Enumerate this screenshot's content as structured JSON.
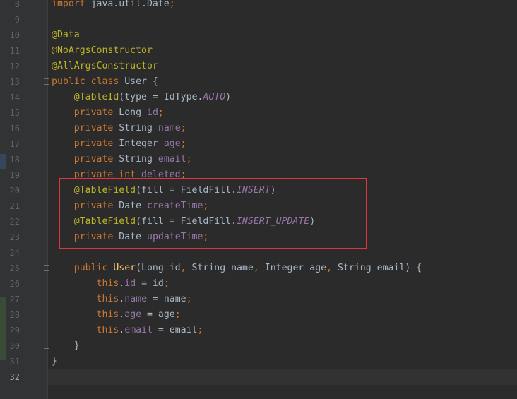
{
  "editor": {
    "colors": {
      "background": "#2b2b2b",
      "gutter": "#313335",
      "keyword": "#cc7832",
      "annotation": "#bbb529",
      "field": "#9876aa",
      "plain": "#a9b7c6",
      "method": "#ffc66d",
      "highlight_box": "#e0353b"
    },
    "current_line": "32",
    "lines": [
      {
        "n": "8",
        "segs": [
          [
            "kw",
            "import"
          ],
          [
            "pl",
            " java.util.Date"
          ],
          [
            "kw",
            ";"
          ]
        ]
      },
      {
        "n": "9",
        "segs": []
      },
      {
        "n": "10",
        "segs": [
          [
            "ann",
            "@Data"
          ]
        ]
      },
      {
        "n": "11",
        "segs": [
          [
            "ann",
            "@NoArgsConstructor"
          ]
        ]
      },
      {
        "n": "12",
        "segs": [
          [
            "ann",
            "@AllArgsConstructor"
          ]
        ]
      },
      {
        "n": "13",
        "fold": true,
        "segs": [
          [
            "kw",
            "public class "
          ],
          [
            "pl",
            "User {"
          ]
        ]
      },
      {
        "n": "14",
        "segs": [
          [
            "pl",
            "    "
          ],
          [
            "ann",
            "@TableId"
          ],
          [
            "pl",
            "(type = IdType."
          ],
          [
            "cst",
            "AUTO"
          ],
          [
            "pl",
            ")"
          ]
        ]
      },
      {
        "n": "15",
        "segs": [
          [
            "pl",
            "    "
          ],
          [
            "kw",
            "private "
          ],
          [
            "pl",
            "Long "
          ],
          [
            "fld",
            "id"
          ],
          [
            "kw",
            ";"
          ]
        ]
      },
      {
        "n": "16",
        "segs": [
          [
            "pl",
            "    "
          ],
          [
            "kw",
            "private "
          ],
          [
            "pl",
            "String "
          ],
          [
            "fld",
            "name"
          ],
          [
            "kw",
            ";"
          ]
        ]
      },
      {
        "n": "17",
        "segs": [
          [
            "pl",
            "    "
          ],
          [
            "kw",
            "private "
          ],
          [
            "pl",
            "Integer "
          ],
          [
            "fld",
            "age"
          ],
          [
            "kw",
            ";"
          ]
        ]
      },
      {
        "n": "18",
        "segs": [
          [
            "pl",
            "    "
          ],
          [
            "kw",
            "private "
          ],
          [
            "pl",
            "String "
          ],
          [
            "fld",
            "email"
          ],
          [
            "kw",
            ";"
          ]
        ]
      },
      {
        "n": "19",
        "segs": [
          [
            "pl",
            "    "
          ],
          [
            "kw",
            "private int "
          ],
          [
            "fld",
            "deleted"
          ],
          [
            "kw",
            ";"
          ]
        ]
      },
      {
        "n": "20",
        "segs": [
          [
            "pl",
            "    "
          ],
          [
            "ann",
            "@TableField"
          ],
          [
            "pl",
            "(fill = FieldFill."
          ],
          [
            "cst",
            "INSERT"
          ],
          [
            "pl",
            ")"
          ]
        ]
      },
      {
        "n": "21",
        "segs": [
          [
            "pl",
            "    "
          ],
          [
            "kw",
            "private "
          ],
          [
            "pl",
            "Date "
          ],
          [
            "fld",
            "createTime"
          ],
          [
            "kw",
            ";"
          ]
        ]
      },
      {
        "n": "22",
        "segs": [
          [
            "pl",
            "    "
          ],
          [
            "ann",
            "@TableField"
          ],
          [
            "pl",
            "(fill = FieldFill."
          ],
          [
            "cst",
            "INSERT_UPDATE"
          ],
          [
            "pl",
            ")"
          ]
        ]
      },
      {
        "n": "23",
        "segs": [
          [
            "pl",
            "    "
          ],
          [
            "kw",
            "private "
          ],
          [
            "pl",
            "Date "
          ],
          [
            "fld",
            "updateTime"
          ],
          [
            "kw",
            ";"
          ]
        ]
      },
      {
        "n": "24",
        "segs": []
      },
      {
        "n": "25",
        "fold": true,
        "segs": [
          [
            "pl",
            "    "
          ],
          [
            "kw",
            "public "
          ],
          [
            "mth",
            "User"
          ],
          [
            "pl",
            "(Long id"
          ],
          [
            "kw",
            ", "
          ],
          [
            "pl",
            "String name"
          ],
          [
            "kw",
            ", "
          ],
          [
            "pl",
            "Integer age"
          ],
          [
            "kw",
            ", "
          ],
          [
            "pl",
            "String email) {"
          ]
        ]
      },
      {
        "n": "26",
        "segs": [
          [
            "pl",
            "        "
          ],
          [
            "kw",
            "this"
          ],
          [
            "pl",
            "."
          ],
          [
            "fld",
            "id"
          ],
          [
            "pl",
            " = id"
          ],
          [
            "kw",
            ";"
          ]
        ]
      },
      {
        "n": "27",
        "segs": [
          [
            "pl",
            "        "
          ],
          [
            "kw",
            "this"
          ],
          [
            "pl",
            "."
          ],
          [
            "fld",
            "name"
          ],
          [
            "pl",
            " = name"
          ],
          [
            "kw",
            ";"
          ]
        ]
      },
      {
        "n": "28",
        "segs": [
          [
            "pl",
            "        "
          ],
          [
            "kw",
            "this"
          ],
          [
            "pl",
            "."
          ],
          [
            "fld",
            "age"
          ],
          [
            "pl",
            " = age"
          ],
          [
            "kw",
            ";"
          ]
        ]
      },
      {
        "n": "29",
        "segs": [
          [
            "pl",
            "        "
          ],
          [
            "kw",
            "this"
          ],
          [
            "pl",
            "."
          ],
          [
            "fld",
            "email"
          ],
          [
            "pl",
            " = email"
          ],
          [
            "kw",
            ";"
          ]
        ]
      },
      {
        "n": "30",
        "fold": true,
        "segs": [
          [
            "pl",
            "    }"
          ]
        ]
      },
      {
        "n": "31",
        "segs": [
          [
            "pl",
            "}"
          ]
        ]
      },
      {
        "n": "32",
        "segs": []
      }
    ]
  }
}
